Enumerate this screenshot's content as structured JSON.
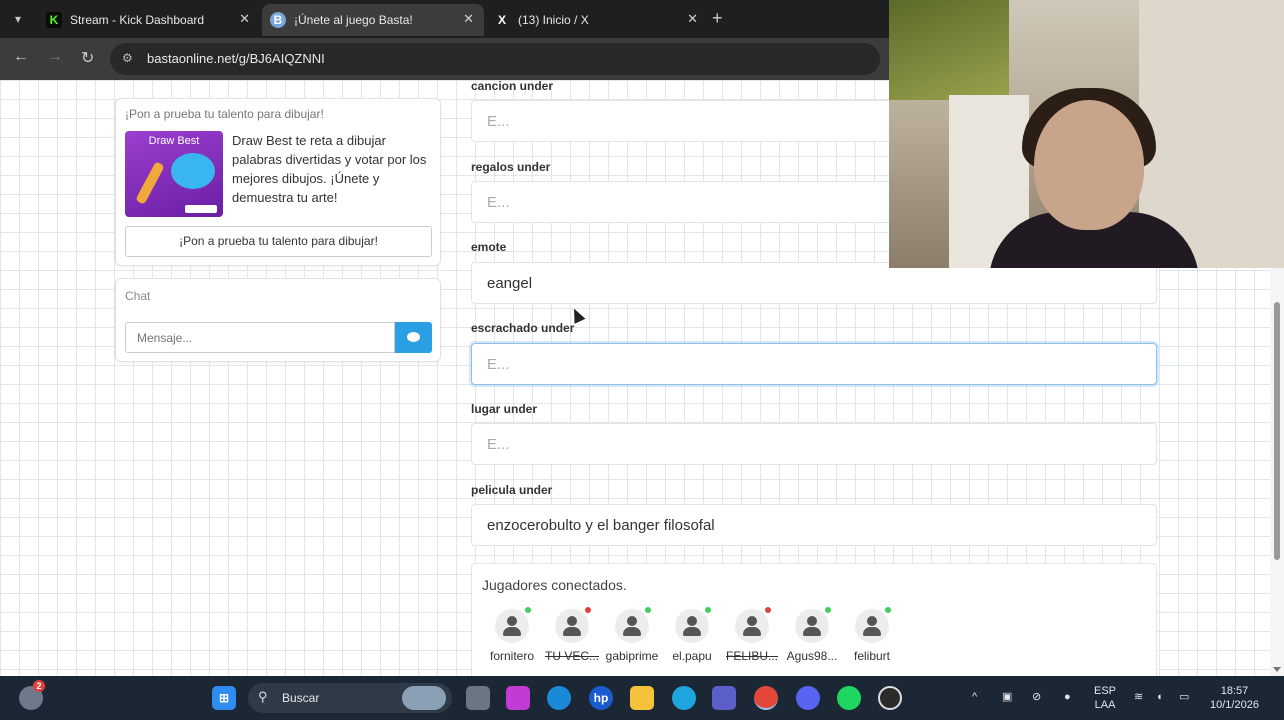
{
  "browser": {
    "tabs": [
      {
        "title": "Stream - Kick Dashboard",
        "favicon": "kick-logo-icon",
        "favicon_glyph": "K",
        "favicon_color": "#53fc18",
        "active": false
      },
      {
        "title": "¡Únete al juego Basta!",
        "favicon": "basta-logo-icon",
        "favicon_glyph": "B",
        "favicon_color": "#7aa7d9",
        "active": true
      },
      {
        "title": "(13) Inicio / X",
        "favicon": "x-logo-icon",
        "favicon_glyph": "X",
        "favicon_color": "#ffffff",
        "active": false
      }
    ],
    "url": "bastaonline.net/g/BJ6AIQZNNI"
  },
  "promo": {
    "heading": "¡Pon a prueba tu talento para dibujar!",
    "image_title": "Draw Best",
    "description": "Draw Best te reta a dibujar palabras divertidas y votar por los mejores dibujos. ¡Únete y demuestra tu arte!",
    "button_label": "¡Pon a prueba tu talento para dibujar!"
  },
  "chat": {
    "heading": "Chat",
    "placeholder": "Mensaje...",
    "send_icon": "speech-bubble-icon"
  },
  "fields": [
    {
      "label": "cancion under",
      "value": "",
      "placeholder": "E..."
    },
    {
      "label": "regalos under",
      "value": "",
      "placeholder": "E..."
    },
    {
      "label": "emote",
      "value": "eangel",
      "placeholder": "E..."
    },
    {
      "label": "escrachado under",
      "value": "",
      "placeholder": "E...",
      "focused": true
    },
    {
      "label": "lugar under",
      "value": "",
      "placeholder": "E..."
    },
    {
      "label": "pelicula under",
      "value": "enzocerobulto y el banger filosofal",
      "placeholder": "E..."
    }
  ],
  "players": {
    "title": "Jugadores conectados.",
    "list": [
      {
        "name": "fornitero",
        "status": "online",
        "strike": false
      },
      {
        "name": "TU VEC...",
        "status": "offline",
        "strike": true
      },
      {
        "name": "gabiprime",
        "status": "online",
        "strike": false
      },
      {
        "name": "el.papu",
        "status": "online",
        "strike": false,
        "host": true
      },
      {
        "name": "FELIBU...",
        "status": "offline",
        "strike": true
      },
      {
        "name": "Agus98...",
        "status": "online",
        "strike": false
      },
      {
        "name": "feliburt",
        "status": "online",
        "strike": false
      }
    ],
    "status_colors": {
      "online": "#3ecf5a",
      "offline": "#e2403b"
    }
  },
  "taskbar": {
    "search_label": "Buscar",
    "weather_badge": "2",
    "language": "ESP",
    "layout": "LAA",
    "time": "18:57",
    "date": "10/1/2026"
  }
}
